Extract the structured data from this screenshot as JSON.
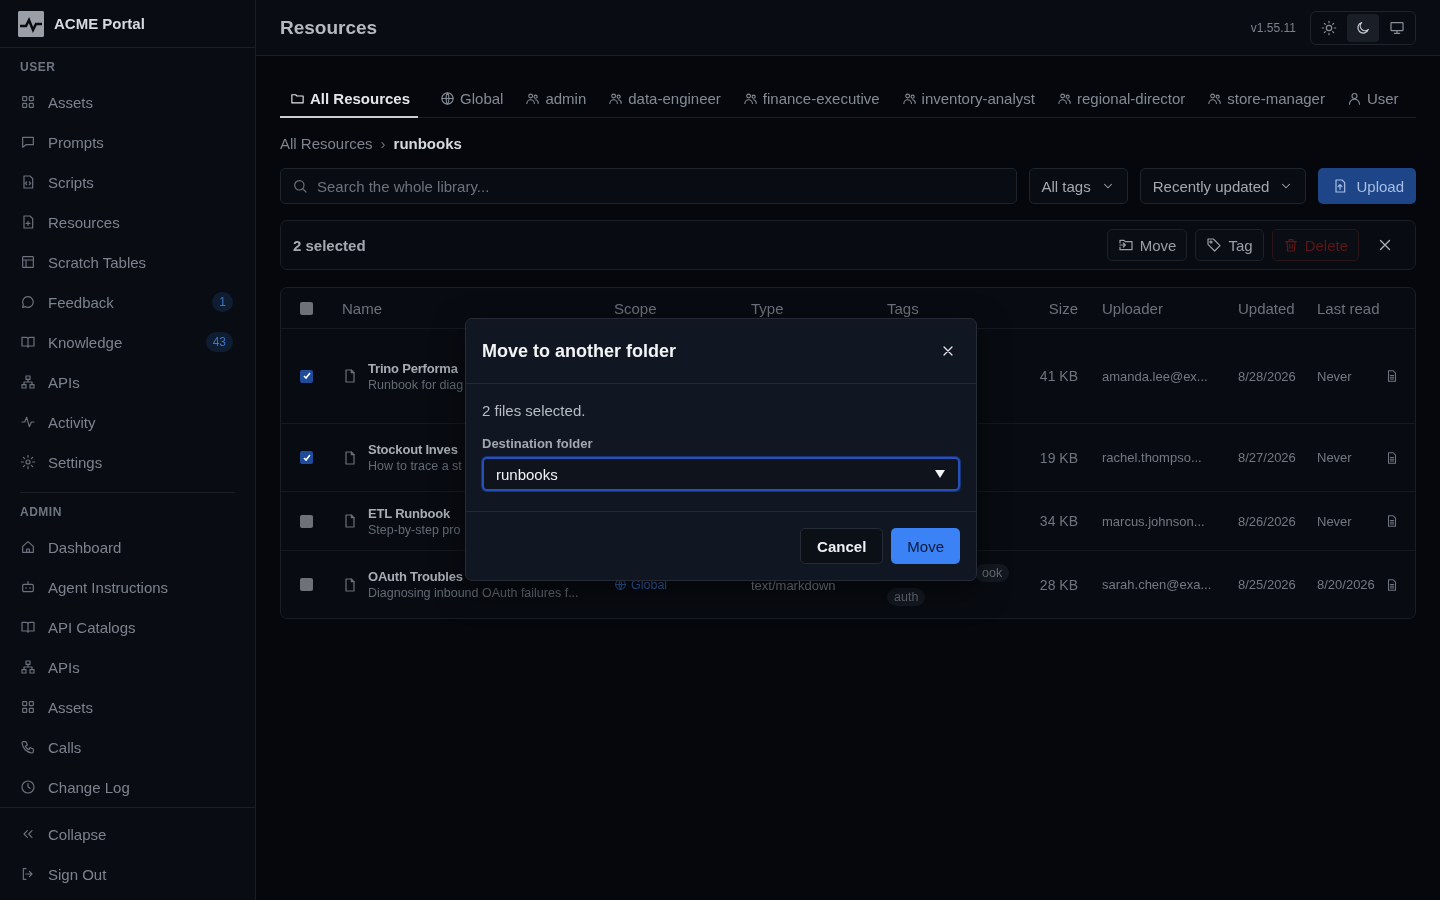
{
  "sidebar": {
    "brand": "ACME Portal",
    "sections": [
      {
        "title": "USER",
        "items": [
          {
            "label": "Assets"
          },
          {
            "label": "Prompts"
          },
          {
            "label": "Scripts"
          },
          {
            "label": "Resources"
          },
          {
            "label": "Scratch Tables"
          },
          {
            "label": "Feedback",
            "badge": "1"
          },
          {
            "label": "Knowledge",
            "badge": "43"
          },
          {
            "label": "APIs"
          },
          {
            "label": "Activity"
          },
          {
            "label": "Settings"
          }
        ]
      },
      {
        "title": "ADMIN",
        "items": [
          {
            "label": "Dashboard"
          },
          {
            "label": "Agent Instructions"
          },
          {
            "label": "API Catalogs"
          },
          {
            "label": "APIs"
          },
          {
            "label": "Assets"
          },
          {
            "label": "Calls"
          },
          {
            "label": "Change Log"
          }
        ]
      }
    ],
    "footer": [
      {
        "label": "Collapse"
      },
      {
        "label": "Sign Out"
      }
    ]
  },
  "header": {
    "title": "Resources",
    "version": "v1.55.11",
    "theme_buttons": [
      {
        "selected": false
      },
      {
        "selected": true
      },
      {
        "selected": false
      }
    ]
  },
  "tabs": [
    {
      "label": "All Resources",
      "selected": true
    },
    {
      "label": "Global",
      "selected": false
    },
    {
      "label": "admin",
      "selected": false
    },
    {
      "label": "data-engineer",
      "selected": false
    },
    {
      "label": "finance-executive",
      "selected": false
    },
    {
      "label": "inventory-analyst",
      "selected": false
    },
    {
      "label": "regional-director",
      "selected": false
    },
    {
      "label": "store-manager",
      "selected": false
    },
    {
      "label": "User",
      "selected": false
    }
  ],
  "breadcrumb": [
    "All Resources",
    "runbooks"
  ],
  "breadcrumb_separator": "›",
  "search": {
    "placeholder": "Search the whole library..."
  },
  "filters": [
    "All tags",
    "Recently updated"
  ],
  "upload": "Upload",
  "selection_bar": {
    "count": "2 selected",
    "actions": [
      {
        "label": "Move",
        "kind": "normal"
      },
      {
        "label": "Tag",
        "kind": "normal"
      },
      {
        "label": "Delete",
        "kind": "danger"
      }
    ]
  },
  "table": {
    "select_all_checked": false,
    "columns": [
      "Name",
      "Scope",
      "Type",
      "Tags",
      "Size",
      "Uploader",
      "Updated",
      "Last read"
    ],
    "rows": [
      {
        "checked": true,
        "name": "Trino Performa",
        "description": "Runbook for diag",
        "tags": [],
        "size": "41 KB",
        "uploader": "amanda.lee@ex...",
        "updated": "8/28/2026",
        "last_read": "Never"
      },
      {
        "checked": true,
        "name": "Stockout Inves",
        "description": "How to trace a st",
        "tags": [],
        "size": "19 KB",
        "uploader": "rachel.thompso...",
        "updated": "8/27/2026",
        "last_read": "Never"
      },
      {
        "checked": false,
        "name": "ETL Runbook",
        "description": "Step-by-step pro",
        "tags": [],
        "size": "34 KB",
        "uploader": "marcus.johnson...",
        "updated": "8/26/2026",
        "last_read": "Never"
      },
      {
        "checked": false,
        "name": "OAuth Troubles",
        "description": "Diagnosing inbound OAuth failures f...",
        "scope": "Global",
        "type": "text/markdown",
        "tags": [
          "ook",
          "auth"
        ],
        "size": "28 KB",
        "uploader": "sarah.chen@exa...",
        "updated": "8/25/2026",
        "last_read": "8/20/2026"
      }
    ]
  },
  "dialog": {
    "title": "Move to another folder",
    "message": "2 files selected.",
    "field_label": "Destination folder",
    "value": "runbooks",
    "buttons": [
      {
        "label": "Cancel",
        "kind": "secondary"
      },
      {
        "label": "Move",
        "kind": "primary"
      }
    ]
  }
}
